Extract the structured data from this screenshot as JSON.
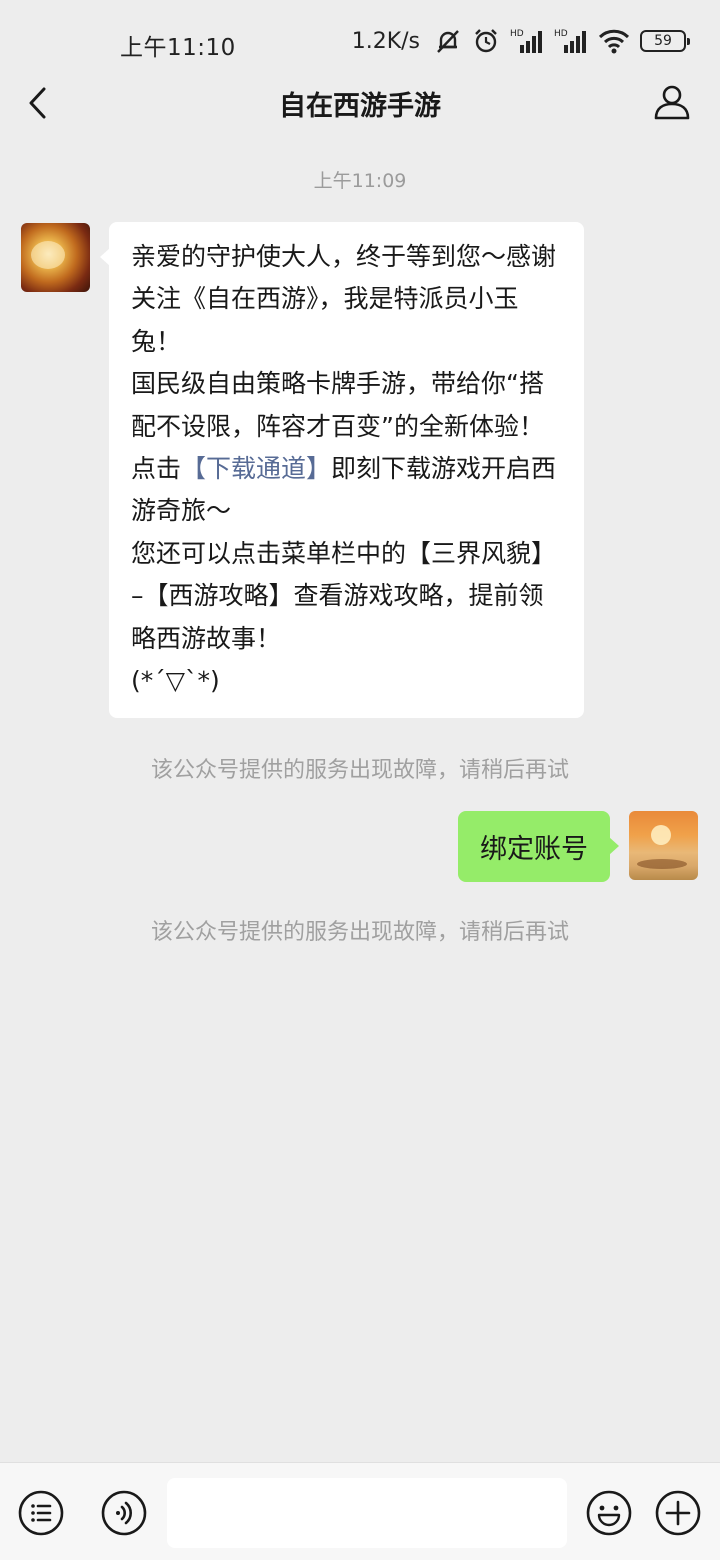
{
  "status_bar": {
    "time": "上午11:10",
    "net_speed": "1.2K/s",
    "battery": "59",
    "icons": [
      "mute-bell-icon",
      "alarm-icon",
      "hd-signal-icon",
      "hd-signal-icon",
      "wifi-icon",
      "battery-icon"
    ]
  },
  "nav": {
    "title": "自在西游手游",
    "back_icon": "chevron-left-icon",
    "profile_icon": "person-icon"
  },
  "chat": {
    "time_label": "上午11:09",
    "incoming": {
      "para1": "亲爱的守护使大人，终于等到您～感谢关注《自在西游》，我是特派员小玉兔！",
      "para2_before": "国民级自由策略卡牌手游，带给你“搭配不设限，阵容才百变”的全新体验！点击",
      "para2_link": "【下载通道】",
      "para2_after": "即刻下载游戏开启西游奇旅～",
      "para3": "您还可以点击菜单栏中的【三界风貌】–【西游攻略】查看游戏攻略，提前领略西游故事！",
      "para4": "(*ˊ▽ˋ*)"
    },
    "system_note_1": "该公众号提供的服务出现故障，请稍后再试",
    "outgoing": "绑定账号",
    "system_note_2": "该公众号提供的服务出现故障，请稍后再试"
  },
  "input_bar": {
    "menu_icon": "list-menu-icon",
    "voice_icon": "voice-icon",
    "input_value": "",
    "emoji_icon": "emoji-icon",
    "plus_icon": "plus-icon"
  }
}
